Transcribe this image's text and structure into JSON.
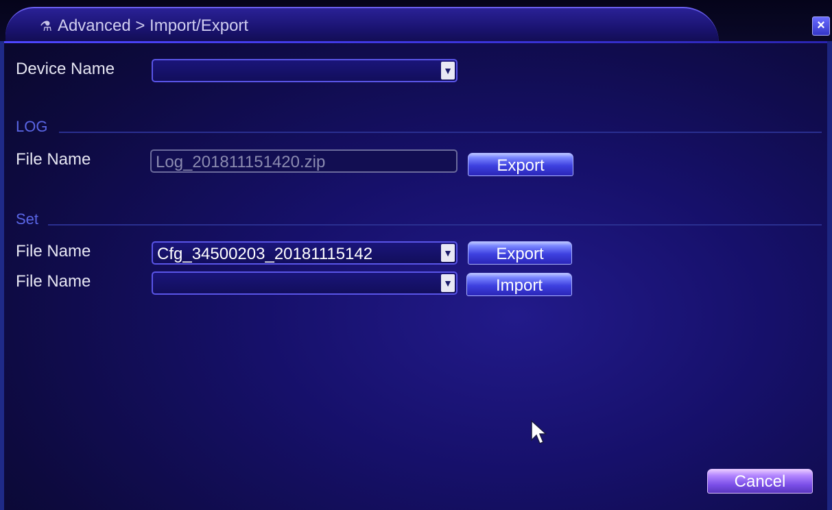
{
  "window": {
    "title": "Advanced > Import/Export",
    "title_icon": "tools-icon",
    "close_symbol": "×"
  },
  "device": {
    "label": "Device Name",
    "value": "",
    "dropdown_symbol": "▼"
  },
  "log": {
    "section_label": "LOG",
    "file_label": "File Name",
    "file_value": "Log_201811151420.zip",
    "export_label": "Export"
  },
  "set": {
    "section_label": "Set",
    "export_file_label": "File Name",
    "export_file_value": "Cfg_34500203_20181115142",
    "export_label": "Export",
    "import_file_label": "File Name",
    "import_file_value": "",
    "import_label": "Import",
    "dropdown_symbol": "▼"
  },
  "footer": {
    "cancel_label": "Cancel"
  },
  "colors": {
    "background": "#16106a",
    "accent": "#4e46ff",
    "section_text": "#5a66e6",
    "cancel_button": "#7b4fe8"
  }
}
